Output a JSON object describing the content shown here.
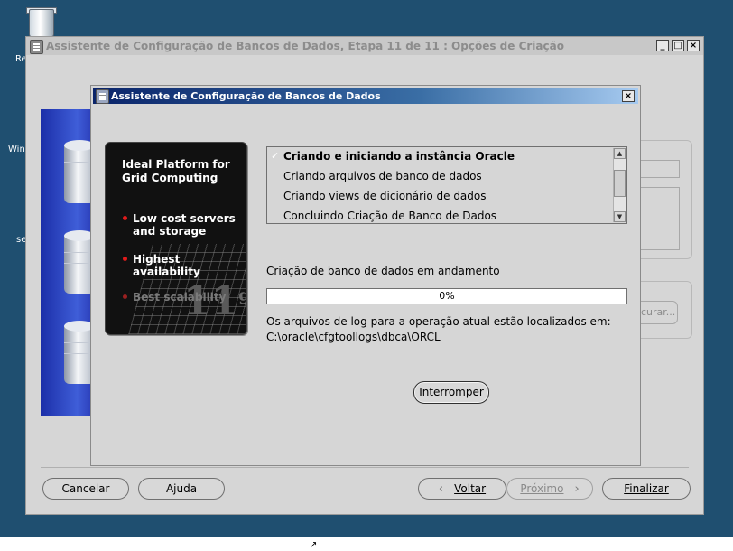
{
  "desktop": {
    "labels": [
      "Re",
      "Win",
      "se"
    ]
  },
  "outer_window": {
    "title": "Assistente de Configuração de Bancos de Dados, Etapa 11 de 11 : Opções de Criação",
    "minimize": "_",
    "maximize": "□",
    "close": "×",
    "ghost_button": "curar...",
    "buttons": {
      "cancel": "Cancelar",
      "help": "Ajuda",
      "back": "Voltar",
      "next": "Próximo",
      "finish": "Finalizar"
    }
  },
  "dialog": {
    "title": "Assistente de Configuração de Bancos de Dados",
    "close": "×",
    "banner": {
      "title": "Ideal Platform for Grid Computing",
      "bullets": [
        "Low cost servers and storage",
        "Highest availability",
        "Best scalability"
      ],
      "logo": "11",
      "logo_sup": "g"
    },
    "steps": [
      {
        "label": "Criando e iniciando a instância Oracle",
        "state": "current"
      },
      {
        "label": "Criando arquivos de banco de dados",
        "state": "pending"
      },
      {
        "label": "Criando views de dicionário de dados",
        "state": "pending"
      },
      {
        "label": "Concluindo Criação de Banco de Dados",
        "state": "pending"
      }
    ],
    "check_mark": "✓",
    "status_text": "Criação de banco de dados em andamento",
    "progress": {
      "value": 0,
      "label": "0%"
    },
    "log_line1": "Os arquivos de log para a operação atual estão localizados em:",
    "log_line2": "C:\\oracle\\cfgtoollogs\\dbca\\ORCL",
    "stop_button": "Interromper"
  }
}
